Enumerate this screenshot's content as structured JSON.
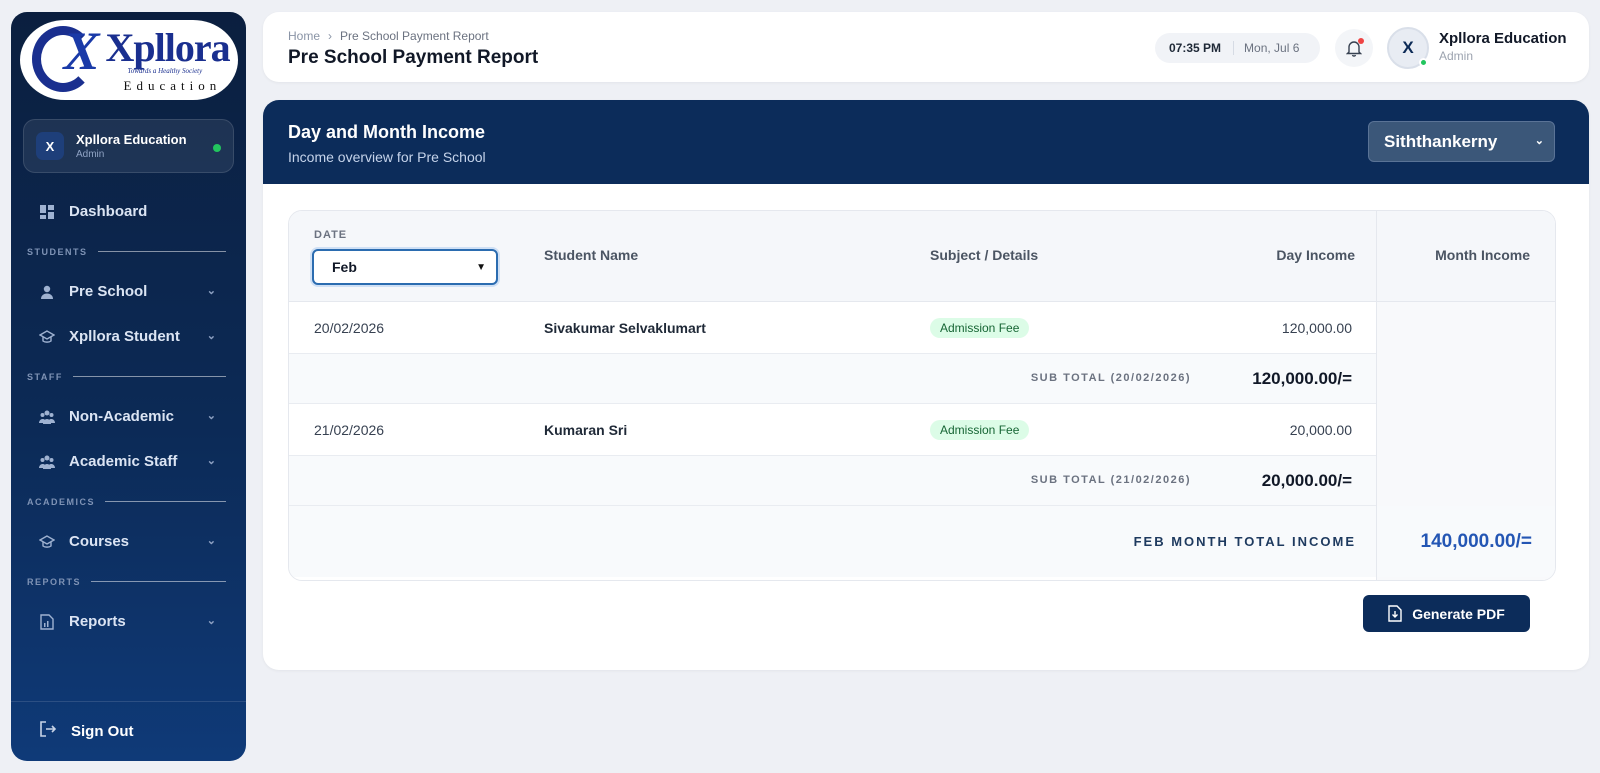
{
  "brand": {
    "logo_word": "Xpllora",
    "logo_tagline": "Towards a Healthy Society",
    "logo_sub": "Education"
  },
  "sidebar": {
    "profile": {
      "name": "Xpllora Education",
      "role": "Admin",
      "initial": "X"
    },
    "dashboard": "Dashboard",
    "sections": {
      "students": "STUDENTS",
      "staff": "STAFF",
      "academics": "ACADEMICS",
      "reports": "REPORTS"
    },
    "items": {
      "pre_school": "Pre School",
      "xpllora_student": "Xpllora Student",
      "non_academic": "Non-Academic",
      "academic_staff": "Academic Staff",
      "courses": "Courses",
      "reports": "Reports"
    },
    "sign_out": "Sign Out"
  },
  "header": {
    "breadcrumb": {
      "home": "Home",
      "current": "Pre School Payment Report"
    },
    "title": "Pre School Payment Report",
    "time": "07:35 PM",
    "date": "Mon, Jul 6",
    "user": {
      "initial": "X",
      "name": "Xpllora Education",
      "role": "Admin"
    }
  },
  "banner": {
    "title": "Day and Month Income",
    "subtitle": "Income overview for Pre School",
    "branch_selected": "Siththankerny"
  },
  "table": {
    "date_label": "DATE",
    "month_selected": "Feb",
    "headers": {
      "student": "Student Name",
      "subject": "Subject / Details",
      "day_income": "Day Income",
      "month_income": "Month Income"
    },
    "rows": [
      {
        "date": "20/02/2026",
        "student": "Sivakumar Selvaklumart",
        "subject": "Admission Fee",
        "day_income": "120,000.00",
        "subtotal_label": "SUB TOTAL (20/02/2026)",
        "subtotal_value": "120,000.00/="
      },
      {
        "date": "21/02/2026",
        "student": "Kumaran Sri",
        "subject": "Admission Fee",
        "day_income": "20,000.00",
        "subtotal_label": "SUB TOTAL (21/02/2026)",
        "subtotal_value": "20,000.00/="
      }
    ],
    "month_total_label": "FEB MONTH TOTAL INCOME",
    "month_total_value": "140,000.00/="
  },
  "actions": {
    "generate_pdf": "Generate PDF"
  },
  "colors": {
    "sidebar": "#0c2a56",
    "banner": "#0c2c5a",
    "accent": "#2456b4",
    "badge_bg": "#dcfce7",
    "online": "#22c55e"
  }
}
